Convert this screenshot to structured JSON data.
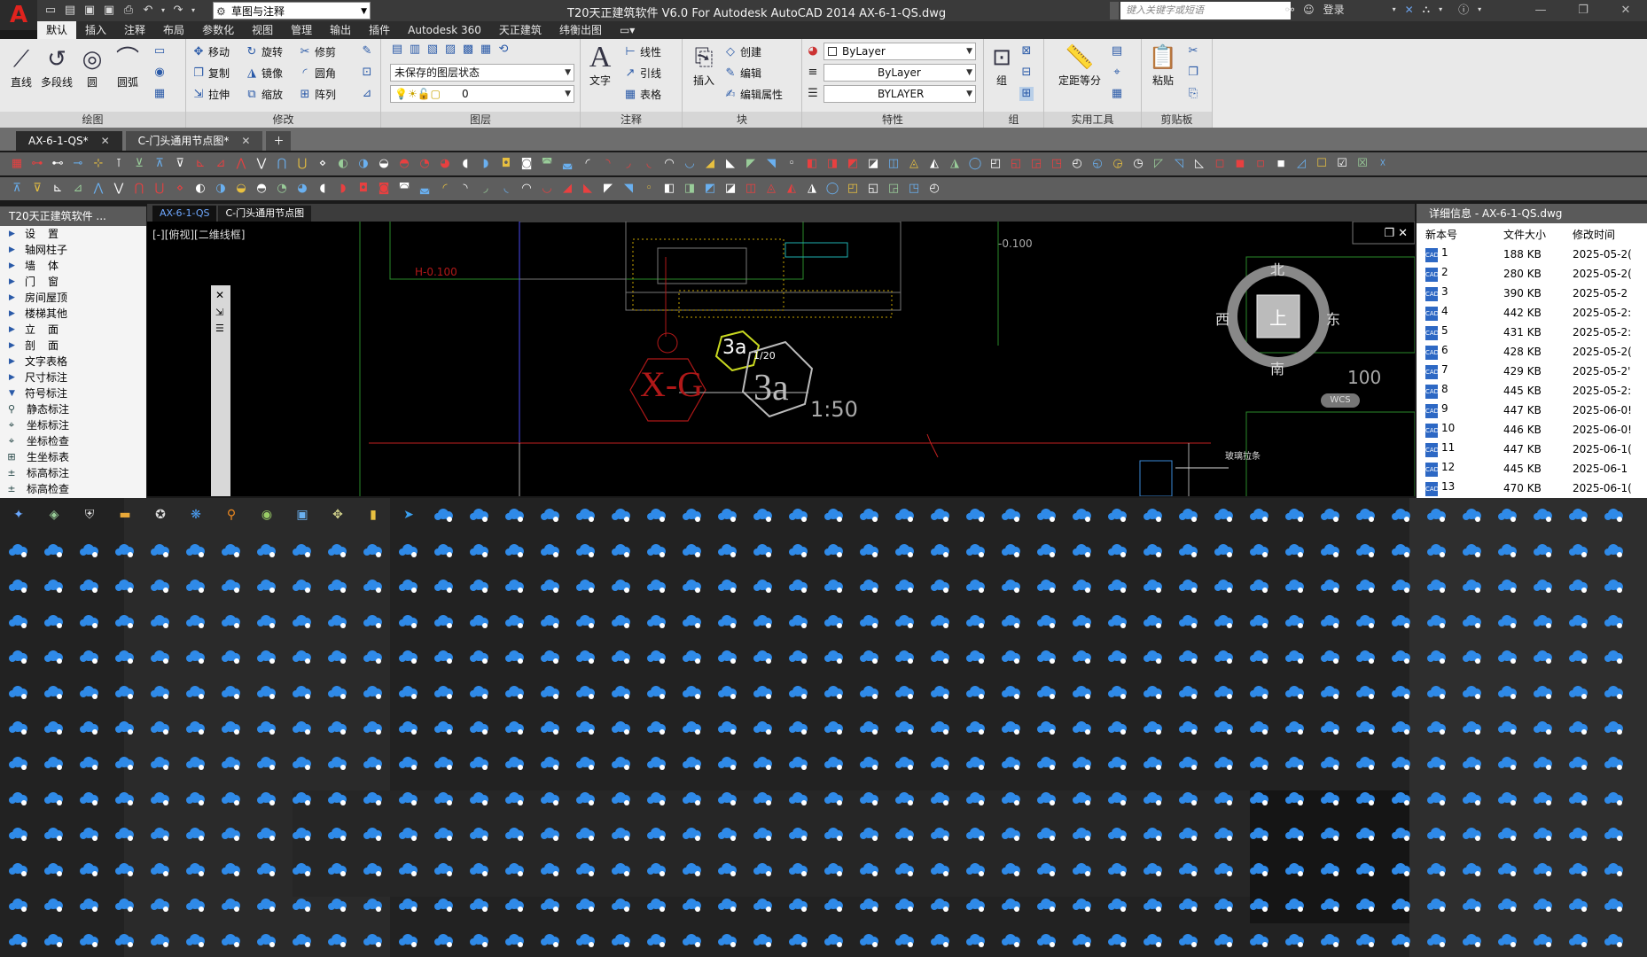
{
  "titlebar": {
    "logo": "A",
    "workspace": "草图与注释",
    "title": "T20天正建筑软件 V6.0 For Autodesk AutoCAD 2014    AX-6-1-QS.dwg",
    "search_placeholder": "键入关键字或短语",
    "login": "登录"
  },
  "ribbon_tabs": [
    "默认",
    "插入",
    "注释",
    "布局",
    "参数化",
    "视图",
    "管理",
    "输出",
    "插件",
    "Autodesk 360",
    "天正建筑",
    "纬衡出图"
  ],
  "ribbon": {
    "draw": {
      "title": "绘图",
      "line": "直线",
      "polyline": "多段线",
      "circle": "圆",
      "arc": "圆弧"
    },
    "modify": {
      "title": "修改",
      "move": "移动",
      "rotate": "旋转",
      "trim": "修剪",
      "copy": "复制",
      "mirror": "镜像",
      "fillet": "圆角",
      "stretch": "拉伸",
      "scale": "缩放",
      "array": "阵列"
    },
    "layers": {
      "title": "图层",
      "state": "未保存的图层状态",
      "layer": "0"
    },
    "annotation": {
      "title": "注释",
      "text": "文字",
      "linear": "线性",
      "leader": "引线",
      "table": "表格"
    },
    "block": {
      "title": "块",
      "insert": "插入",
      "create": "创建",
      "edit": "编辑",
      "edit_attr": "编辑属性"
    },
    "properties": {
      "title": "特性",
      "color": "ByLayer",
      "linetype": "ByLayer",
      "lineweight": "BYLAYER"
    },
    "groups": {
      "title": "组",
      "group": "组"
    },
    "utilities": {
      "title": "实用工具",
      "measure": "定距等分"
    },
    "clipboard": {
      "title": "剪贴板",
      "paste": "粘贴"
    }
  },
  "doc_tabs": [
    {
      "label": "AX-6-1-QS*",
      "active": true
    },
    {
      "label": "C-门头通用节点图*",
      "active": false
    }
  ],
  "left_panel": {
    "title": "T20天正建筑软件 ...",
    "items": [
      {
        "label": "设置",
        "spaced": true
      },
      {
        "label": "轴网柱子",
        "spaced": false
      },
      {
        "label": "墙体",
        "spaced": true
      },
      {
        "label": "门窗",
        "spaced": true
      },
      {
        "label": "房间屋顶",
        "spaced": false
      },
      {
        "label": "楼梯其他",
        "spaced": false
      },
      {
        "label": "立面",
        "spaced": true
      },
      {
        "label": "剖面",
        "spaced": true
      },
      {
        "label": "文字表格",
        "spaced": false
      },
      {
        "label": "尺寸标注",
        "spaced": false
      },
      {
        "label": "符号标注",
        "spaced": false
      }
    ],
    "sub_items": [
      "静态标注",
      "坐标标注",
      "坐标检查",
      "生坐标表",
      "标高标注",
      "标高检查"
    ]
  },
  "drawing": {
    "tabs": [
      "AX-6-1-QS",
      "C-门头通用节点图"
    ],
    "view_label": "[-][俯视][二维线框]",
    "texts": {
      "h_level": "H-0.100",
      "level_right": "-0.100",
      "xg": "X-G",
      "tag1": "3a",
      "tag2": "3a",
      "ratio1": "1/20",
      "scale": "1:50",
      "note": "玻璃拉条",
      "num100": "100"
    }
  },
  "viewcube": {
    "north": "北",
    "south": "南",
    "east": "东",
    "west": "西",
    "top": "上",
    "wcs": "WCS"
  },
  "right_panel": {
    "title": "详细信息 - AX-6-1-QS.dwg",
    "columns": [
      "新本号",
      "文件大小",
      "修改时间"
    ],
    "rows": [
      {
        "v": "1",
        "size": "188 KB",
        "time": "2025-05-2("
      },
      {
        "v": "2",
        "size": "280 KB",
        "time": "2025-05-2("
      },
      {
        "v": "3",
        "size": "390 KB",
        "time": "2025-05-2"
      },
      {
        "v": "4",
        "size": "442 KB",
        "time": "2025-05-2:"
      },
      {
        "v": "5",
        "size": "431 KB",
        "time": "2025-05-2:"
      },
      {
        "v": "6",
        "size": "428 KB",
        "time": "2025-05-2("
      },
      {
        "v": "7",
        "size": "429 KB",
        "time": "2025-05-2'"
      },
      {
        "v": "8",
        "size": "445 KB",
        "time": "2025-05-2:"
      },
      {
        "v": "9",
        "size": "447 KB",
        "time": "2025-06-0!"
      },
      {
        "v": "10",
        "size": "446 KB",
        "time": "2025-06-0!"
      },
      {
        "v": "11",
        "size": "447 KB",
        "time": "2025-06-1("
      },
      {
        "v": "12",
        "size": "445 KB",
        "time": "2025-06-1"
      },
      {
        "v": "13",
        "size": "470 KB",
        "time": "2025-06-1("
      }
    ]
  },
  "colors": {
    "cad_red": "#e0231e",
    "icon_blue": "#2f8ae8",
    "canvas": "#000000"
  }
}
